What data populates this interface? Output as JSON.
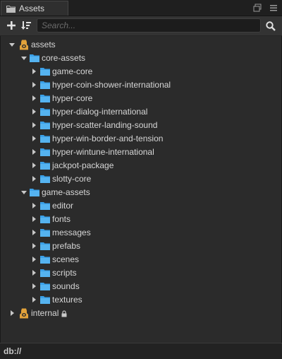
{
  "panel": {
    "title": "Assets"
  },
  "search": {
    "placeholder": "Search..."
  },
  "tree": {
    "root_assets": "assets",
    "core_assets": "core-assets",
    "core_children": [
      "game-core",
      "hyper-coin-shower-international",
      "hyper-core",
      "hyper-dialog-international",
      "hyper-scatter-landing-sound",
      "hyper-win-border-and-tension",
      "hyper-wintune-international",
      "jackpot-package",
      "slotty-core"
    ],
    "game_assets": "game-assets",
    "game_children": [
      "editor",
      "fonts",
      "messages",
      "prefabs",
      "scenes",
      "scripts",
      "sounds",
      "textures"
    ],
    "root_internal": "internal"
  },
  "status": {
    "path": "db://"
  },
  "colors": {
    "folder": "#3aa0e8",
    "db_icon": "#e2a23b",
    "background": "#2b2b2b"
  }
}
